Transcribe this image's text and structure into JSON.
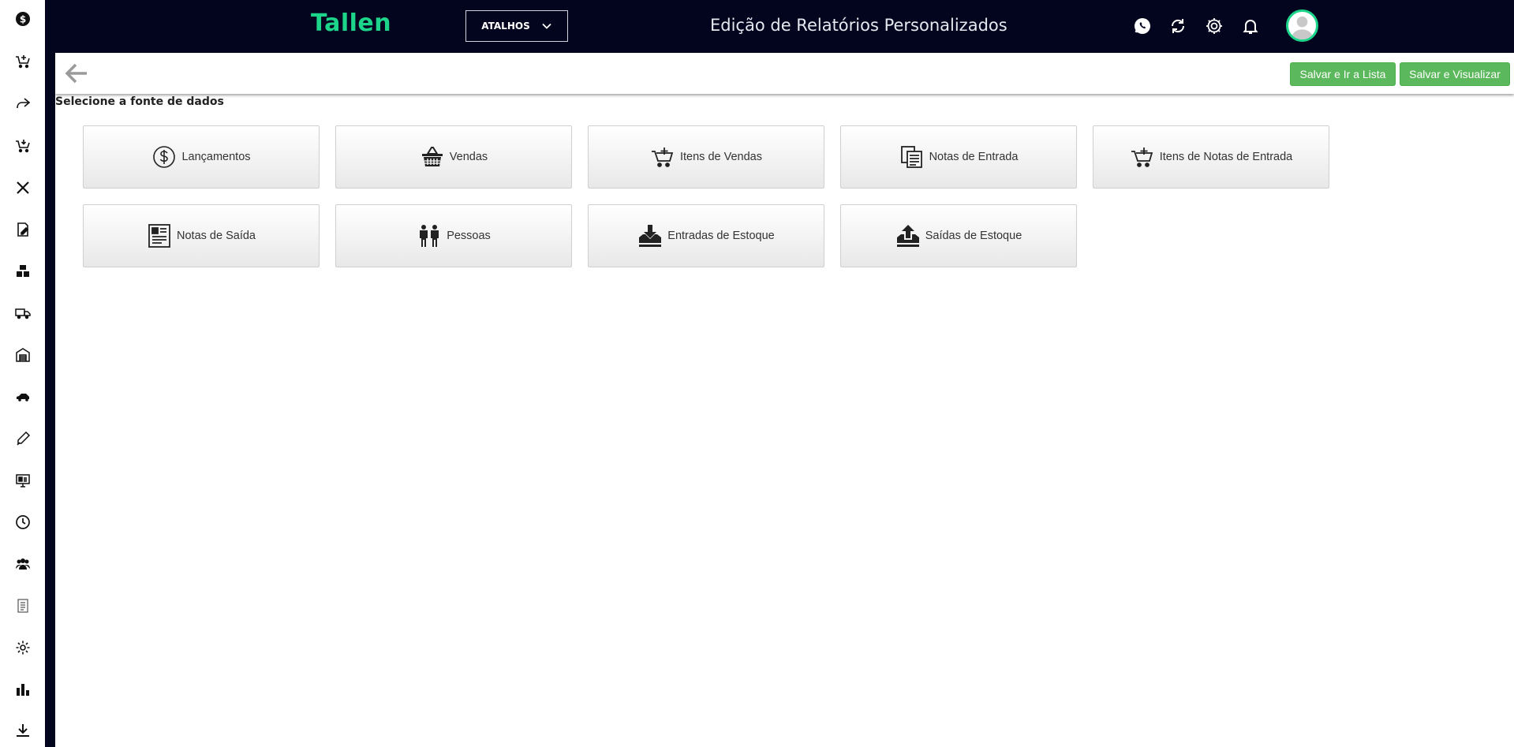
{
  "app": {
    "logo": "Tallen",
    "shortcuts_label": "ATALHOS",
    "page_title": "Edição de Relatórios Personalizados",
    "brand_color": "#1dd58a",
    "header_bg": "#03051e"
  },
  "header_icons": [
    "whatsapp-icon",
    "sync-icon",
    "gear-icon",
    "bell-icon"
  ],
  "sidebar": {
    "icons": [
      "dollar-icon",
      "cart-add-icon",
      "share-icon",
      "cart-icon",
      "tools-icon",
      "document-edit-icon",
      "boxes-icon",
      "truck-icon",
      "warehouse-icon",
      "car-icon",
      "pen-icon",
      "monitor-icon",
      "clock-icon",
      "users-icon",
      "report-icon",
      "gear-icon",
      "bar-chart-icon",
      "download-icon"
    ]
  },
  "toolbar": {
    "save_list_label": "Salvar e Ir a Lista",
    "save_view_label": "Salvar e Visualizar",
    "button_color": "#5cb85c"
  },
  "content": {
    "section_label": "Selecione a fonte de dados",
    "sources": [
      {
        "label": "Lançamentos",
        "icon": "dollar-circle-icon"
      },
      {
        "label": "Vendas",
        "icon": "basket-icon"
      },
      {
        "label": "Itens de Vendas",
        "icon": "cart-add-icon"
      },
      {
        "label": "Notas de Entrada",
        "icon": "copy-document-icon"
      },
      {
        "label": "Itens de Notas de Entrada",
        "icon": "cart-add-icon"
      },
      {
        "label": "Notas de Saída",
        "icon": "list-document-icon"
      },
      {
        "label": "Pessoas",
        "icon": "people-icon"
      },
      {
        "label": "Entradas de Estoque",
        "icon": "tray-download-icon"
      },
      {
        "label": "Saídas de Estoque",
        "icon": "tray-upload-icon"
      }
    ]
  }
}
